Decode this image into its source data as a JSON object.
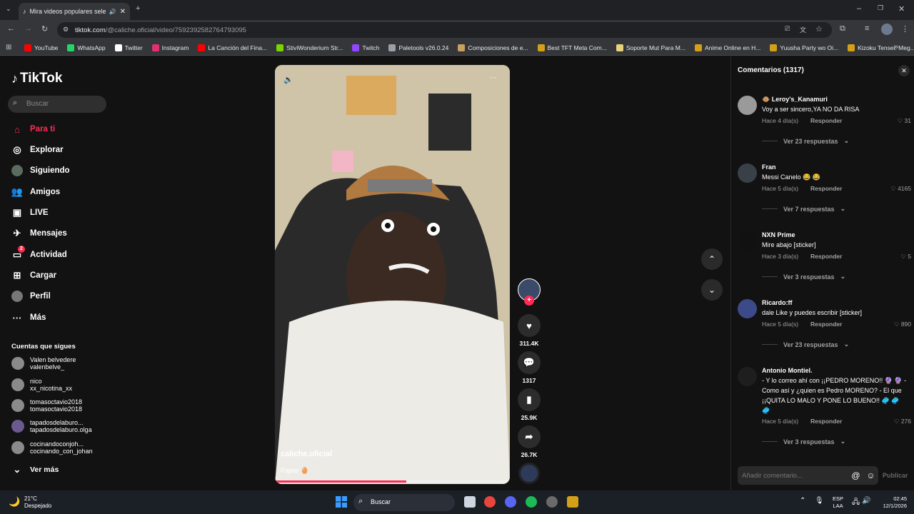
{
  "browser": {
    "tab_title": "Mira videos populares sele",
    "url_domain": "tiktok.com",
    "url_path": "/@caliche.oficial/video/7592392582764793095",
    "bookmarks": [
      {
        "label": "YouTube",
        "color": "#ff0000"
      },
      {
        "label": "WhatsApp",
        "color": "#25d366"
      },
      {
        "label": "Twitter",
        "color": "#ffffff"
      },
      {
        "label": "Instagram",
        "color": "#e1306c"
      },
      {
        "label": "La Canción del Fina...",
        "color": "#ff0000"
      },
      {
        "label": "StiviWonderium Str...",
        "color": "#7bd300"
      },
      {
        "label": "Twitch",
        "color": "#9146ff"
      },
      {
        "label": "Paletools v26.0.24",
        "color": "#9aa0a6"
      },
      {
        "label": "Composiciones de e...",
        "color": "#c8a060"
      },
      {
        "label": "Best TFT Meta Com...",
        "color": "#d4a017"
      },
      {
        "label": "Soporte Mut Para M...",
        "color": "#e6d27a"
      },
      {
        "label": "Anime Online en H...",
        "color": "#d4a017"
      },
      {
        "label": "Yuusha Party wo Oi...",
        "color": "#d4a017"
      },
      {
        "label": "Kizoku Tensei: Meg...",
        "color": "#d4a017"
      }
    ]
  },
  "sidebar": {
    "logo": "TikTok",
    "search_placeholder": "Buscar",
    "nav": [
      {
        "label": "Para ti",
        "icon": "home-icon",
        "active": true
      },
      {
        "label": "Explorar",
        "icon": "compass-icon"
      },
      {
        "label": "Siguiendo",
        "icon": "following-icon"
      },
      {
        "label": "Amigos",
        "icon": "friends-icon"
      },
      {
        "label": "LIVE",
        "icon": "live-icon"
      },
      {
        "label": "Mensajes",
        "icon": "messages-icon"
      },
      {
        "label": "Actividad",
        "icon": "activity-icon",
        "badge": "2"
      },
      {
        "label": "Cargar",
        "icon": "upload-icon"
      },
      {
        "label": "Perfil",
        "icon": "profile-icon"
      },
      {
        "label": "Más",
        "icon": "more-icon"
      }
    ],
    "following_title": "Cuentas que sigues",
    "accounts": [
      {
        "name": "Valen belvedere",
        "handle": "valenbelve_"
      },
      {
        "name": "nico",
        "handle": "xx_nicotina_xx"
      },
      {
        "name": "tomasoctavio2018",
        "handle": "tomasoctavio2018"
      },
      {
        "name": "tapadosdelaburo...",
        "handle": "tapadosdelaburo.olga"
      },
      {
        "name": "cocinandoconjoh...",
        "handle": "cocinando_con_johan"
      }
    ],
    "see_more": "Ver más"
  },
  "video": {
    "author": "caliche.oficial",
    "caption": "Papas 🥚",
    "progress": 0.56
  },
  "actions": {
    "likes": "311.4K",
    "comments": "1317",
    "saves": "25.9K",
    "shares": "26.7K"
  },
  "comments": {
    "title": "Comentarios",
    "count": "(1317)",
    "reply_label": "Responder",
    "items": [
      {
        "user": "🐵 Leroy's_Kanamuri",
        "text": "Voy a ser sincero,YA NO DA RISA",
        "time": "Hace 4 día(s)",
        "likes": "31",
        "replies": "Ver 23 respuestas"
      },
      {
        "user": "Fran",
        "text": "Messi Canelo 😂 😂",
        "time": "Hace 5 día(s)",
        "likes": "4165",
        "replies": "Ver 7 respuestas"
      },
      {
        "user": "NXN Prime",
        "text": "Mire abajo [sticker]",
        "time": "Hace 3 día(s)",
        "likes": "5",
        "replies": "Ver 3 respuestas"
      },
      {
        "user": "Ricardo:ff",
        "text": "dale Like y puedes escribir [sticker]",
        "time": "Hace 5 día(s)",
        "likes": "890",
        "replies": "Ver 23 respuestas"
      },
      {
        "user": "Antonio Montiel.",
        "text": "- Y lo correo ahí con ¡¡PEDRO MORENO!! 🔮 🔮 - Como así y ¿quien es Pedro MORENO? - El que ¡¡QUITA LO MALO Y PONE LO BUENO!! 🥏 🥏 🥏",
        "time": "Hace 5 día(s)",
        "likes": "276",
        "replies": "Ver 3 respuestas"
      }
    ],
    "input_placeholder": "Añadir comentario...",
    "publish": "Publicar"
  },
  "taskbar": {
    "weather_temp": "21°C",
    "weather_desc": "Despejado",
    "search": "Buscar",
    "lang": "ESP",
    "region": "LAA",
    "time": "02:45",
    "date": "12/1/2026"
  }
}
